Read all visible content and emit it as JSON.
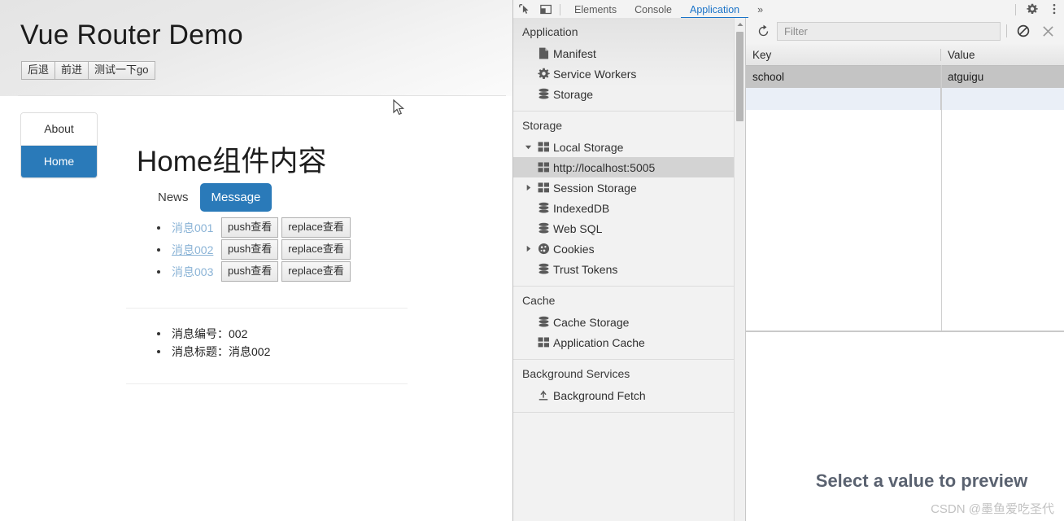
{
  "page": {
    "title": "Vue Router Demo",
    "nav_buttons": [
      {
        "label": "后退",
        "name": "back-button"
      },
      {
        "label": "前进",
        "name": "forward-button"
      },
      {
        "label": "测试一下go",
        "name": "go-test-button"
      }
    ],
    "sidebar": {
      "items": [
        {
          "label": "About",
          "active": false
        },
        {
          "label": "Home",
          "active": true
        }
      ]
    },
    "content_title": "Home组件内容",
    "tabs": [
      {
        "label": "News",
        "active": false
      },
      {
        "label": "Message",
        "active": true
      }
    ],
    "messages": [
      {
        "link": "消息001",
        "underlined": false,
        "push": "push查看",
        "replace": "replace查看"
      },
      {
        "link": "消息002",
        "underlined": true,
        "push": "push查看",
        "replace": "replace查看"
      },
      {
        "link": "消息003",
        "underlined": false,
        "push": "push查看",
        "replace": "replace查看"
      }
    ],
    "detail": [
      "消息编号：002",
      "消息标题：消息002"
    ],
    "colors": {
      "accent": "#2a7ab9",
      "link": "#8ab3d6"
    }
  },
  "devtools": {
    "tabs": [
      {
        "label": "Elements",
        "active": false
      },
      {
        "label": "Console",
        "active": false
      },
      {
        "label": "Application",
        "active": true
      },
      {
        "label": "»",
        "active": false
      }
    ],
    "icons": {
      "inspect": "inspect-element-icon",
      "device": "device-toolbar-icon",
      "settings": "gear-icon",
      "more": "more-vertical-icon"
    },
    "sidebar": {
      "application": {
        "title": "Application",
        "items": [
          {
            "label": "Manifest",
            "icon": "manifest-file-icon",
            "arrow": "none",
            "selected": false
          },
          {
            "label": "Service Workers",
            "icon": "gear-icon",
            "arrow": "none",
            "selected": false
          },
          {
            "label": "Storage",
            "icon": "database-icon",
            "arrow": "none",
            "selected": false
          }
        ]
      },
      "storage": {
        "title": "Storage",
        "items": [
          {
            "label": "Local Storage",
            "icon": "table-icon",
            "arrow": "down",
            "selected": false,
            "indent": 0
          },
          {
            "label": "http://localhost:5005",
            "icon": "table-icon",
            "arrow": "none",
            "selected": true,
            "indent": 1
          },
          {
            "label": "Session Storage",
            "icon": "table-icon",
            "arrow": "right",
            "selected": false,
            "indent": 0
          },
          {
            "label": "IndexedDB",
            "icon": "database-icon",
            "arrow": "none",
            "selected": false,
            "indent": 0
          },
          {
            "label": "Web SQL",
            "icon": "database-icon",
            "arrow": "none",
            "selected": false,
            "indent": 0
          },
          {
            "label": "Cookies",
            "icon": "cookie-icon",
            "arrow": "right",
            "selected": false,
            "indent": 0
          },
          {
            "label": "Trust Tokens",
            "icon": "database-icon",
            "arrow": "none",
            "selected": false,
            "indent": 0
          }
        ]
      },
      "cache": {
        "title": "Cache",
        "items": [
          {
            "label": "Cache Storage",
            "icon": "database-icon",
            "arrow": "none",
            "selected": false
          },
          {
            "label": "Application Cache",
            "icon": "table-icon",
            "arrow": "none",
            "selected": false
          }
        ]
      },
      "background": {
        "title": "Background Services",
        "items": [
          {
            "label": "Background Fetch",
            "icon": "background-fetch-icon",
            "arrow": "none",
            "selected": false
          }
        ]
      }
    },
    "toolbar": {
      "refresh_icon": "refresh-icon",
      "filter_placeholder": "Filter",
      "clear_icon": "clear-all-icon",
      "delete_icon": "delete-selected-icon"
    },
    "table": {
      "columns": [
        "Key",
        "Value"
      ],
      "rows": [
        {
          "key": "school",
          "value": "atguigu",
          "selected": true
        }
      ]
    },
    "preview": {
      "message": "Select a value to preview"
    }
  },
  "watermark": "CSDN @墨鱼爱吃圣代"
}
